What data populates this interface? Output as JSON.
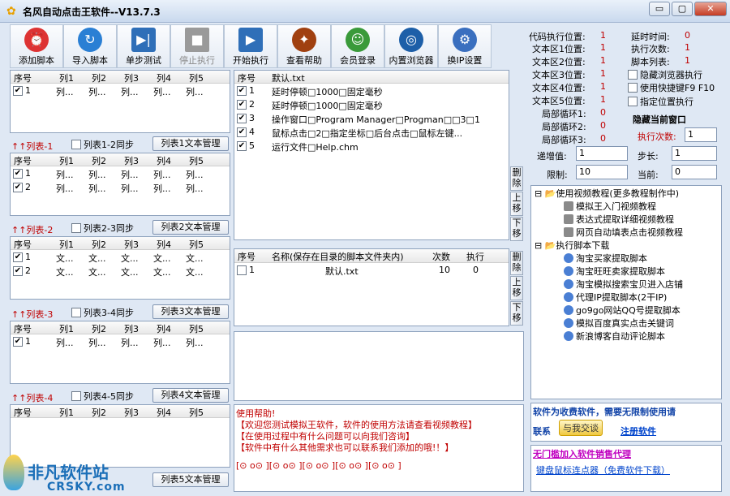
{
  "window": {
    "title": "名风自动点击王软件--V13.7.3",
    "min": "▭",
    "max": "▢",
    "close": "✕"
  },
  "toolbar": [
    {
      "label": "添加脚本",
      "icon": "alarm-clock-icon",
      "disabled": false
    },
    {
      "label": "导入脚本",
      "icon": "import-icon",
      "disabled": false
    },
    {
      "label": "单步测试",
      "icon": "step-icon",
      "disabled": false
    },
    {
      "label": "停止执行",
      "icon": "stop-icon",
      "disabled": true
    },
    {
      "label": "开始执行",
      "icon": "play-icon",
      "disabled": false
    },
    {
      "label": "查看帮助",
      "icon": "magic-wand-icon",
      "disabled": false
    },
    {
      "label": "会员登录",
      "icon": "user-icon",
      "disabled": false
    },
    {
      "label": "内置浏览器",
      "icon": "globe-icon",
      "disabled": false
    },
    {
      "label": "换IP设置",
      "icon": "gear-icon",
      "disabled": false
    }
  ],
  "list_columns": [
    "序号",
    "列1",
    "列2",
    "列3",
    "列4",
    "列5"
  ],
  "list0": {
    "rows": [
      {
        "checked": true,
        "cells": [
          "1",
          "列...",
          "列...",
          "列...",
          "列...",
          "列..."
        ]
      }
    ]
  },
  "list1": {
    "label": "↑↑列表-1",
    "sync": "列表1-2同步",
    "manage": "列表1文本管理",
    "rows": [
      {
        "checked": true,
        "cells": [
          "1",
          "列...",
          "列...",
          "列...",
          "列...",
          "列..."
        ]
      },
      {
        "checked": true,
        "cells": [
          "2",
          "列...",
          "列...",
          "列...",
          "列...",
          "列..."
        ]
      }
    ]
  },
  "list2": {
    "label": "↑↑列表-2",
    "sync": "列表2-3同步",
    "manage": "列表2文本管理",
    "rows": [
      {
        "checked": true,
        "cells": [
          "1",
          "文...",
          "文...",
          "文...",
          "文...",
          "文..."
        ]
      },
      {
        "checked": true,
        "cells": [
          "2",
          "文...",
          "文...",
          "文...",
          "文...",
          "文..."
        ]
      }
    ]
  },
  "list3": {
    "label": "↑↑列表-3",
    "sync": "列表3-4同步",
    "manage": "列表3文本管理",
    "rows": [
      {
        "checked": true,
        "cells": [
          "1",
          "列...",
          "列...",
          "列...",
          "列...",
          "列..."
        ]
      }
    ]
  },
  "list4": {
    "label": "↑↑列表-4",
    "sync": "列表4-5同步",
    "manage": "列表4文本管理",
    "rows": []
  },
  "list5": {
    "manage": "列表5文本管理"
  },
  "script": {
    "col_no": "序号",
    "col_name": "默认.txt",
    "rows": [
      {
        "no": "1",
        "text": "延时停顿□1000□固定毫秒"
      },
      {
        "no": "2",
        "text": "延时停顿□1000□固定毫秒"
      },
      {
        "no": "3",
        "text": "操作窗口□Program Manager□Progman□□3□1"
      },
      {
        "no": "4",
        "text": "鼠标点击□2□指定坐标□后台点击□鼠标左键..."
      },
      {
        "no": "5",
        "text": "运行文件□Help.chm"
      }
    ],
    "side_btns": [
      "删除",
      "上移",
      "下移"
    ]
  },
  "files": {
    "cols": [
      "序号",
      "名称(保存在目录的脚本文件夹内)",
      "次数",
      "执行"
    ],
    "rows": [
      {
        "no": "1",
        "name": "默认.txt",
        "count": "10",
        "exec": "0"
      }
    ],
    "side_btns": [
      "删除",
      "上移",
      "下移"
    ]
  },
  "help": {
    "title": "使用帮助!",
    "lines": [
      "【欢迎您测试模拟王软件，软件的使用方法请查看视频教程】",
      "【在使用过程中有什么问题可以向我们咨询】",
      "【软件中有什么其他需求也可以联系我们添加的哦!！】",
      "[⊙ o⊙ ][⊙ o⊙ ][⊙ o⊙ ][⊙ o⊙ ][⊙ o⊙ ]"
    ]
  },
  "status": {
    "labels": [
      "代码执行位置:",
      "文本区1位置:",
      "文本区2位置:",
      "文本区3位置:",
      "文本区4位置:",
      "文本区5位置:",
      "局部循环1:",
      "局部循环2:",
      "局部循环3:"
    ],
    "values": [
      "1",
      "1",
      "1",
      "1",
      "1",
      "1",
      "0",
      "0",
      "0"
    ],
    "right_labels": [
      "延时时间:",
      "执行次数:",
      "脚本列表:"
    ],
    "right_values": [
      "0",
      "1",
      "1"
    ],
    "checks": [
      "隐藏浏览器执行",
      "使用快捷键F9 F10",
      "指定位置执行"
    ],
    "hide_window": "隐藏当前窗口",
    "exec_count_label": "执行次数:",
    "exec_count": "1",
    "inc_label": "递增值:",
    "inc": "1",
    "step_label": "步长:",
    "step": "1",
    "limit_label": "限制:",
    "limit": "10",
    "current_label": "当前:",
    "current": "0"
  },
  "tree": {
    "group1": "使用视频教程(更多教程制作中)",
    "group1_items": [
      "模拟王入门视频教程",
      "表达式提取详细视频教程",
      "网页自动填表点击视频教程"
    ],
    "group2": "执行脚本下载",
    "group2_items": [
      "淘宝买家提取脚本",
      "淘宝旺旺卖家提取脚本",
      "淘宝模拟搜索宝贝进入店铺",
      "代理IP提取脚本(2干IP)",
      "go9go网站QQ号提取脚本",
      "模拟百度真实点击关键词",
      "新浪博客自动评论脚本"
    ]
  },
  "promo": {
    "line1": "软件为收费软件，需要无限制使用请",
    "line2": "联系",
    "chat_btn": "与我交谈",
    "register": "注册软件",
    "agent": "无门槛加入软件销售代理",
    "link": "键盘鼠标连点器（免费软件下载）"
  },
  "watermark": {
    "line1": "非凡软件站",
    "line2": "CRSKY.com"
  }
}
